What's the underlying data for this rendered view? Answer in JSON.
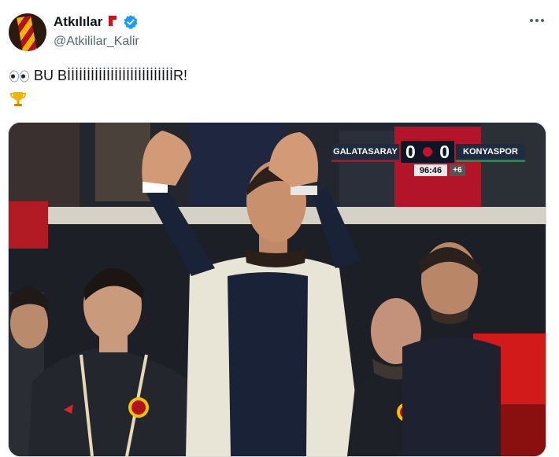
{
  "tweet": {
    "display_name": "Atkılılar",
    "handle": "@Atkililar_Kalir",
    "text_line1": "BU BİİİİİİİİİİİİİİİİİİİİİİİİİİİR!",
    "icons": [
      "scarf-emoji",
      "verified-badge-icon",
      "more-icon",
      "eyes-emoji",
      "trophy-emoji"
    ],
    "verified_color": "#1d9bf0"
  },
  "scoreboard": {
    "home_team": "GALATASARAY",
    "home_score": "0",
    "away_score": "0",
    "away_team": "KONYASPOR",
    "time": "96:46",
    "added_time": "+6"
  }
}
